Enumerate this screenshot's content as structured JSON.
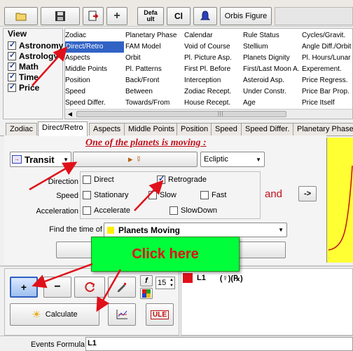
{
  "toolbar": {
    "defa_label_top": "Defa",
    "defa_label_bottom": "ult",
    "cl_label": "Cl",
    "orbis_label": "Orbis Figure"
  },
  "view": {
    "title": "View",
    "items": [
      {
        "label": "Astronomy",
        "checked": true
      },
      {
        "label": "Astrology",
        "checked": true
      },
      {
        "label": "Math",
        "checked": true
      },
      {
        "label": "Time",
        "checked": true
      },
      {
        "label": "Price",
        "checked": true
      }
    ]
  },
  "grid": {
    "col1": [
      "Zodiac",
      "Direct/Retro",
      "Aspects",
      "Middle Points",
      "Position",
      "Speed",
      "Speed Differ."
    ],
    "col2": [
      "Planetary Phase",
      "FAM Model",
      "Orbit",
      "Pl. Patterns",
      "Back/Front",
      "Between",
      "Towards/From"
    ],
    "col3": [
      "Calendar",
      "Void of Course",
      "Pl. Picture Asp.",
      "First Pl. Before",
      "Interception",
      "Zodiac Recept.",
      "House Recept."
    ],
    "col4": [
      "Rule Status",
      "Stellium",
      "Planets Dignity",
      "First/Last Moon A.",
      "Asteroid Asp.",
      "Under Constr.",
      "Age"
    ],
    "col5": [
      "Cycles/Gravit.",
      "Angle Diff./Orbit",
      "Pl. Hours/Lunar D",
      "Experement.",
      "Price Regress.",
      "Price Bar Prop.",
      "Price Itself"
    ]
  },
  "tabs": [
    "Zodiac",
    "Direct/Retro",
    "Aspects",
    "Middle Points",
    "Position",
    "Speed",
    "Speed Differ.",
    "Planetary Phase"
  ],
  "panel": {
    "headline": "One of the planets is moving :",
    "transit_label": "Transit",
    "planet_glyphs": "▸ ☿",
    "ecliptic": "Ecliptic",
    "direction_label": "Direction",
    "direct": "Direct",
    "retrograde": "Retrograde",
    "speed_label": "Speed",
    "stationary": "Stationary",
    "slow": "Slow",
    "fast": "Fast",
    "acceleration_label": "Acceleration",
    "accelerate": "Accelerate",
    "slowdown": "SlowDown",
    "and_label": "and",
    "next_arrow": "->",
    "find_time_label": "Find the time of",
    "planets_moving": "Planets Moving"
  },
  "callout": {
    "text": "Click here"
  },
  "bottom": {
    "f_label": "f",
    "number_value": "15",
    "calculate_label": "Calculate",
    "ule_label": "ULE",
    "formula_l1": "L1",
    "formula_glyphs": "(☿)(℞)",
    "events_formula_label": "Events Formula",
    "events_formula_value": "L1"
  },
  "colors": {
    "accent_red": "#e0101a",
    "callout_green": "#00ff3a",
    "headline_red": "#c0101a",
    "chart_yellow": "#ffff33",
    "selection_blue": "#3163c5"
  }
}
